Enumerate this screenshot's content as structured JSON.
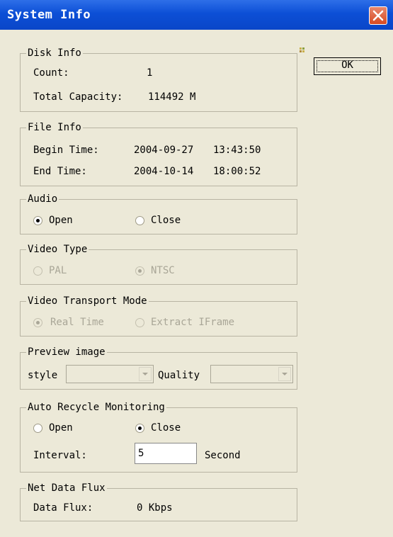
{
  "window": {
    "title": "System Info",
    "close_icon": "close-x-icon"
  },
  "ok_button": {
    "label": "OK"
  },
  "disk_info": {
    "legend": "Disk Info",
    "count_label": "Count:",
    "count_value": "1",
    "capacity_label": "Total Capacity:",
    "capacity_value": "114492 M"
  },
  "file_info": {
    "legend": "File Info",
    "begin_label": "Begin Time:",
    "begin_date": "2004-09-27",
    "begin_time": "13:43:50",
    "end_label": "End Time:",
    "end_date": "2004-10-14",
    "end_time": "18:00:52"
  },
  "audio": {
    "legend": "Audio",
    "open_label": "Open",
    "close_label": "Close",
    "selected": "Open"
  },
  "video_type": {
    "legend": "Video Type",
    "pal_label": "PAL",
    "ntsc_label": "NTSC",
    "selected": "NTSC",
    "enabled": false
  },
  "transport_mode": {
    "legend": "Video Transport Mode",
    "realtime_label": "Real Time",
    "iframe_label": "Extract IFrame",
    "selected": "Real Time",
    "enabled": false
  },
  "preview_image": {
    "legend": "Preview image",
    "style_label": "style",
    "quality_label": "Quality",
    "style_value": "",
    "quality_value": ""
  },
  "auto_recycle": {
    "legend": "Auto Recycle Monitoring",
    "open_label": "Open",
    "close_label": "Close",
    "selected": "Close",
    "interval_label": "Interval:",
    "interval_value": "5",
    "interval_unit": "Second"
  },
  "net_flux": {
    "legend": "Net Data Flux",
    "flux_label": "Data Flux:",
    "flux_value": "0 Kbps"
  },
  "colors": {
    "titlebar": "#0c4fd6",
    "window_bg": "#ece9d8",
    "close_button": "#d84a22",
    "disabled_text": "#a9a697"
  }
}
